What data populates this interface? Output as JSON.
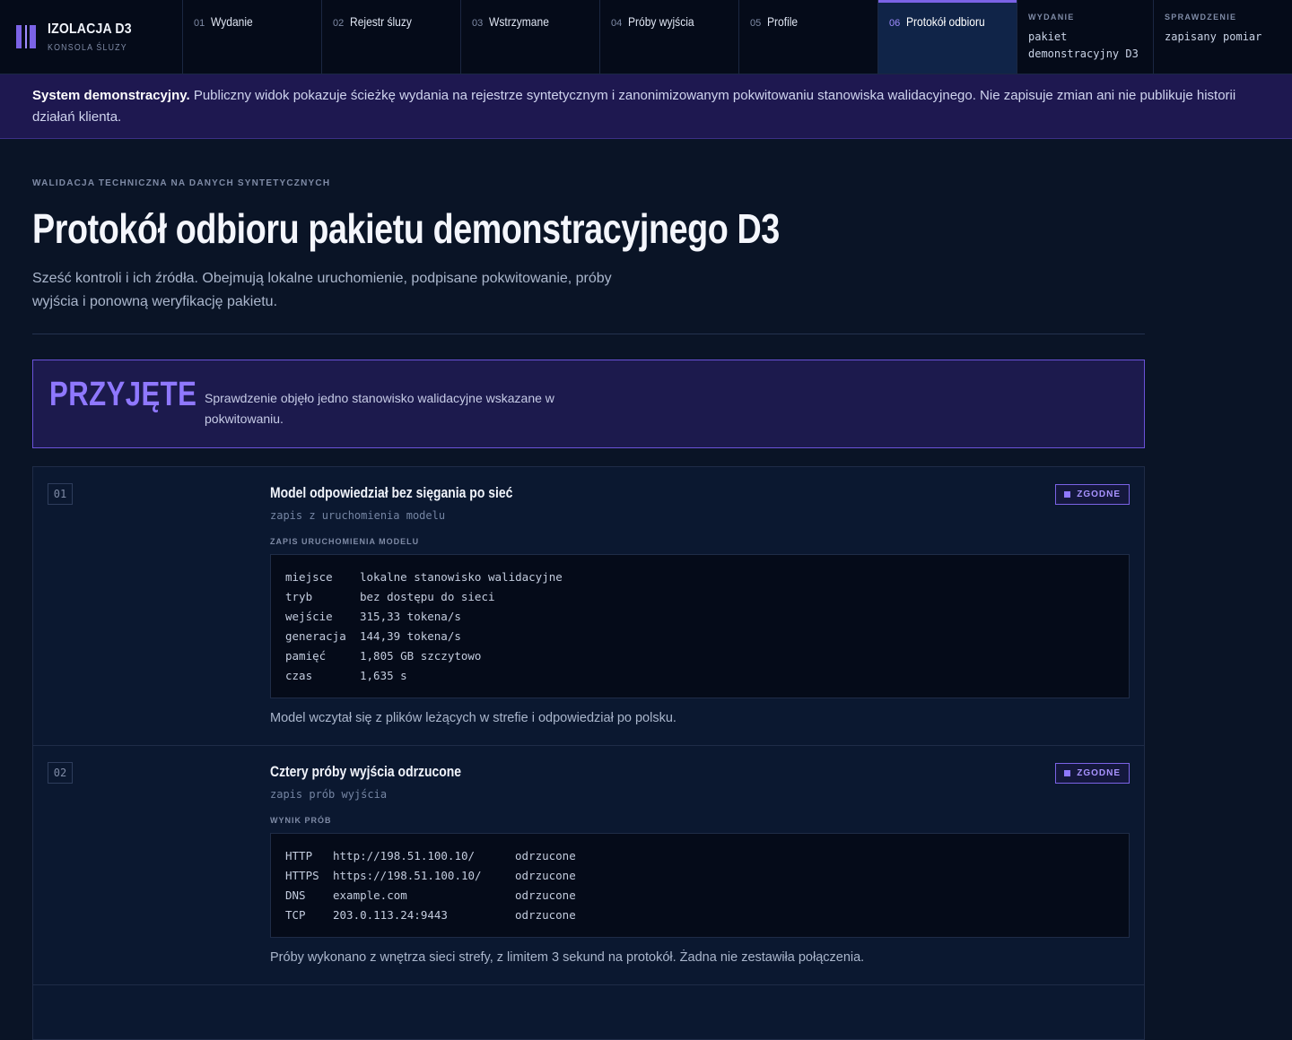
{
  "brand": {
    "title": "IZOLACJA D3",
    "subtitle": "KONSOLA ŚLUZY"
  },
  "nav": [
    {
      "num": "01",
      "label": "Wydanie"
    },
    {
      "num": "02",
      "label": "Rejestr śluzy"
    },
    {
      "num": "03",
      "label": "Wstrzymane"
    },
    {
      "num": "04",
      "label": "Próby wyjścia"
    },
    {
      "num": "05",
      "label": "Profile"
    },
    {
      "num": "06",
      "label": "Protokół odbioru"
    }
  ],
  "info": {
    "release_label": "WYDANIE",
    "release_value": "pakiet demonstracyjny D3",
    "check_label": "SPRAWDZENIE",
    "check_value": "zapisany pomiar"
  },
  "banner": {
    "strong": "System demonstracyjny.",
    "text": "Publiczny widok pokazuje ścieżkę wydania na rejestrze syntetycznym i zanonimizowanym pokwitowaniu stanowiska walidacyjnego. Nie zapisuje zmian ani nie publikuje historii działań klienta."
  },
  "page": {
    "eyebrow": "WALIDACJA TECHNICZNA NA DANYCH SYNTETYCZNYCH",
    "title": "Protokół odbioru pakietu demonstracyjnego D3",
    "lede": "Sześć kontroli i ich źródła. Obejmują lokalne uruchomienie, podpisane pokwitowanie, próby wyjścia i ponowną weryfikację pakietu."
  },
  "verdict": {
    "word": "PRZYJĘTE",
    "text": "Sprawdzenie objęło jedno stanowisko walidacyjne wskazane w pokwitowaniu."
  },
  "checks": [
    {
      "num": "01",
      "title": "Model odpowiedział bez sięgania po sieć",
      "source": "zapis z uruchomienia modelu",
      "status": "ZGODNE",
      "block_label": "ZAPIS URUCHOMIENIA MODELU",
      "rows": [
        [
          "miejsce",
          "lokalne stanowisko walidacyjne"
        ],
        [
          "tryb",
          "bez dostępu do sieci"
        ],
        [
          "wejście",
          "315,33 tokena/s"
        ],
        [
          "generacja",
          "144,39 tokena/s"
        ],
        [
          "pamięć",
          "1,805 GB szczytowo"
        ],
        [
          "czas",
          "1,635 s"
        ]
      ],
      "note": "Model wczytał się z plików leżących w strefie i odpowiedział po polsku."
    },
    {
      "num": "02",
      "title": "Cztery próby wyjścia odrzucone",
      "source": "zapis prób wyjścia",
      "status": "ZGODNE",
      "block_label": "WYNIK PRÓB",
      "rows": [
        [
          "HTTP",
          "http://198.51.100.10/",
          "odrzucone"
        ],
        [
          "HTTPS",
          "https://198.51.100.10/",
          "odrzucone"
        ],
        [
          "DNS",
          "example.com",
          "odrzucone"
        ],
        [
          "TCP",
          "203.0.113.24:9443",
          "odrzucone"
        ]
      ],
      "note": "Próby wykonano z wnętrza sieci strefy, z limitem 3 sekund na protokół. Żadna nie zestawiła połączenia."
    }
  ]
}
